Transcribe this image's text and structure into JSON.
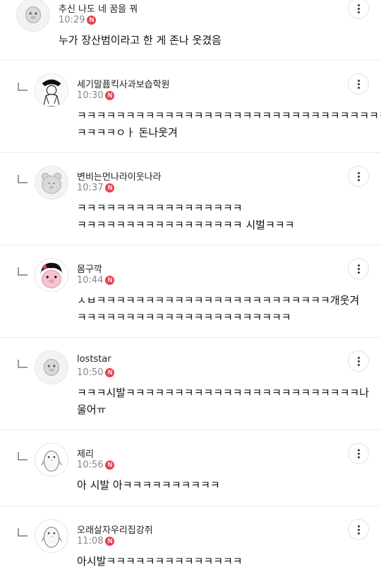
{
  "comments": [
    {
      "nick": "추신 나도 네 꿈을 꿔",
      "time": "10:29",
      "badge": "N",
      "lines": [
        "누가 장산범이라고 한 게 존나 웃겼음"
      ],
      "avatar": "gray-character-icon"
    },
    {
      "nick": "세기말퓹킥사과보습학원",
      "time": "10:30",
      "badge": "N",
      "lines": [
        "ㅋㅋㅋㅋㅋㅋㅋㅋㅋㅋㅋㅋㅋㅋㅋㅋㅋㅋㅋㅋㅋㅋㅋㅋㅋㅋㅋㅋㅋㅋㅋㅋ",
        "ㅋㅋㅋㅋㅇㅏ 돈나웃겨"
      ],
      "avatar": "sketch-figure-icon"
    },
    {
      "nick": "변비는먼나라이웃나라",
      "time": "10:37",
      "badge": "N",
      "lines": [
        "ㅋㅋㅋㅋㅋㅋㅋㅋㅋㅋㅋㅋㅋㅋㅋㅋㅋ",
        "ㅋㅋㅋㅋㅋㅋㅋㅋㅋㅋㅋㅋㅋㅋㅋㅋㅋ 시벌ㅋㅋㅋ"
      ],
      "avatar": "gray-bear-icon"
    },
    {
      "nick": "몸구깍",
      "time": "10:44",
      "badge": "N",
      "lines": [
        "ㅅㅂㅋㅋㅋㅋㅋㅋㅋㅋㅋㅋㅋㅋㅋㅋㅋㅋㅋㅋㅋㅋㅋㅋㅋㅋ개웃겨",
        "ㅋㅋㅋㅋㅋㅋㅋㅋㅋㅋㅋㅋㅋㅋㅋㅋㅋㅋㅋㅋㅋㅋ"
      ],
      "avatar": "pink-pig-girl-icon"
    },
    {
      "nick": "loststar",
      "time": "10:50",
      "badge": "N",
      "lines": [
        "ㅋㅋㅋ시발ㅋㅋㅋㅋㅋㅋㅋㅋㅋㅋㅋㅋㅋㅋㅋㅋㅋㅋㅋㅋㅋㅋㅋㅋ나",
        "울어ㅠ"
      ],
      "avatar": "gray-character-icon"
    },
    {
      "nick": "제리",
      "time": "10:56",
      "badge": "N",
      "lines": [
        "아 시발 아ㅋㅋㅋㅋㅋㅋㅋㅋㅋㅋ"
      ],
      "avatar": "penguin-icon"
    },
    {
      "nick": "오래살자우리집강쥐",
      "time": "11:08",
      "badge": "N",
      "lines": [
        "아시발ㅋㅋㅋㅋㅋㅋㅋㅋㅋㅋㅋㅋㅋㅋ"
      ],
      "avatar": "penguin-icon"
    }
  ],
  "colors": {
    "badge": "#e8414f",
    "divider": "#ececec",
    "time": "#888888"
  }
}
